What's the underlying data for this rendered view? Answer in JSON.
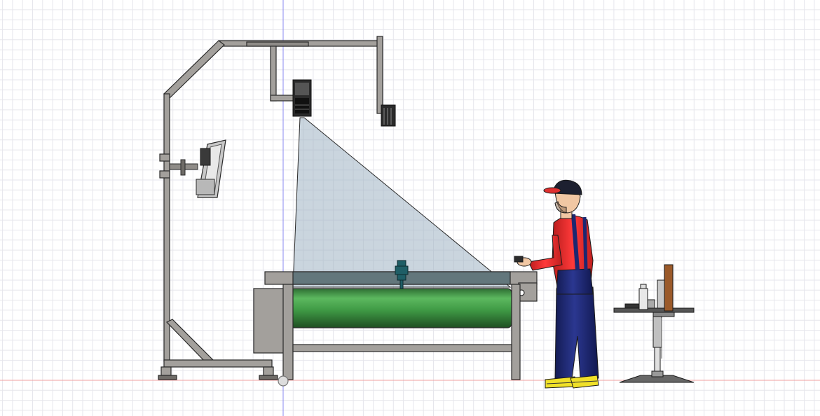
{
  "canvas": {
    "background": "#ffffff",
    "grid_minor_color": "#e6e6ec",
    "grid_major_color": "#cfcfd8",
    "axis_vertical_color": "#8a8af0",
    "axis_horizontal_color": "#f0a0a0"
  },
  "colors": {
    "frame_fill": "#a3a09c",
    "frame_stroke": "#2a2a2a",
    "camera_body": "#2b2b2b",
    "light_cone": "#9fb3c2",
    "light_cone_opacity": 0.55,
    "conveyor_green": "#3f9a45",
    "conveyor_green_dark": "#215a25",
    "table_top_dark": "#4e6a72",
    "cutter_head": "#1f5e66",
    "worker_shirt": "#e02a2a",
    "worker_trousers": "#1d2770",
    "worker_cap": "#1d2030",
    "worker_cap_brim": "#e03030",
    "worker_boots": "#f0e028",
    "monitor_body": "#c8c8c8",
    "desk_wood": "#9b5a2a"
  },
  "objects": {
    "gantry": "gantry-frame",
    "overhead_camera": "camera-icon",
    "side_camera": "camera-icon",
    "monitor": "monitor-icon",
    "conveyor": "conveyor-belt",
    "cutter": "cutter-head-icon",
    "worker": "worker-figure",
    "workstation": "workstation-desk"
  }
}
